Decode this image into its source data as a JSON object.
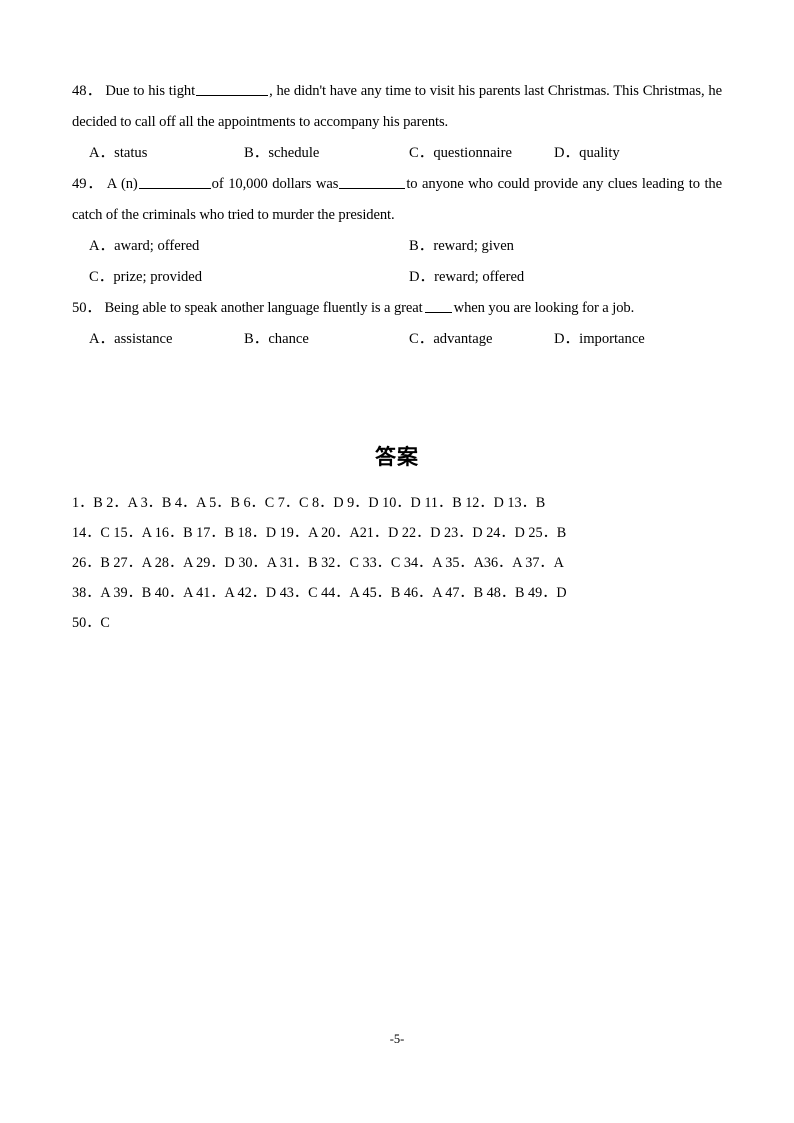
{
  "document": {
    "page_footer": "-5-"
  },
  "questions": [
    {
      "number": "48．",
      "stem_part1": "Due to his tight",
      "stem_part2": ", he didn't have any time to visit his parents last Christmas. This Christmas, he decided to call off all the appointments to accompany his parents.",
      "layout": "four",
      "options": [
        {
          "label": "A．",
          "text": "status"
        },
        {
          "label": "B．",
          "text": "schedule"
        },
        {
          "label": "C．",
          "text": "questionnaire"
        },
        {
          "label": "D．",
          "text": "quality"
        }
      ]
    },
    {
      "number": "49．",
      "stem_part1": "A (n)",
      "stem_part2": "of 10,000 dollars was",
      "stem_part3": "to anyone who could provide any clues leading to the catch of the criminals who tried to murder the president.",
      "layout": "two",
      "options": [
        {
          "label": "A．",
          "text": "award; offered"
        },
        {
          "label": "B．",
          "text": "reward; given"
        },
        {
          "label": "C．",
          "text": "prize; provided"
        },
        {
          "label": "D．",
          "text": "reward; offered"
        }
      ]
    },
    {
      "number": "50．",
      "stem_part1": "Being able to speak another language fluently is a great",
      "stem_part2": "when you are looking for a job.",
      "layout": "four",
      "options": [
        {
          "label": "A．",
          "text": "assistance"
        },
        {
          "label": "B．",
          "text": "chance"
        },
        {
          "label": "C．",
          "text": "advantage"
        },
        {
          "label": "D．",
          "text": "importance"
        }
      ]
    }
  ],
  "answers": {
    "title": "答案",
    "rows": [
      "1．B  2．A  3．B  4．A  5．B  6．C  7．C  8．D  9．D  10．D  11．B  12．D  13．B",
      "14．C  15．A  16．B  17．B  18．D  19．A  20．A21．D  22．D  23．D  24．D  25．B",
      "26．B  27．A  28．A  29．D  30．A  31．B  32．C  33．C  34．A  35．A36．A  37．A",
      "38．A  39．B  40．A  41．A  42．D  43．C  44．A  45．B  46．A  47．B  48．B  49．D",
      "50．C"
    ]
  }
}
